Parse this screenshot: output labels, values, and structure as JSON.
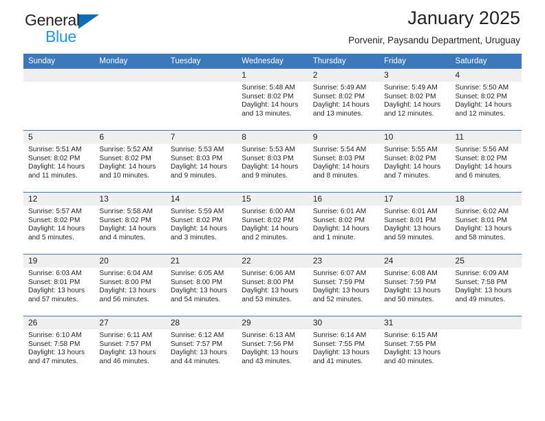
{
  "brand": {
    "line1": "General",
    "line2": "Blue",
    "triangle_color": "#0f6cb6",
    "blue_text_color": "#2196e8"
  },
  "header": {
    "title": "January 2025",
    "subtitle": "Porvenir, Paysandu Department, Uruguay"
  },
  "theme": {
    "header_blue": "#3c78bc",
    "daynum_band": "#efefef",
    "text": "#231f20"
  },
  "weekday_headers": [
    "Sunday",
    "Monday",
    "Tuesday",
    "Wednesday",
    "Thursday",
    "Friday",
    "Saturday"
  ],
  "weeks": [
    [
      {
        "day": "",
        "blank": true
      },
      {
        "day": "",
        "blank": true
      },
      {
        "day": "",
        "blank": true
      },
      {
        "day": "1",
        "sunrise": "Sunrise: 5:48 AM",
        "sunset": "Sunset: 8:02 PM",
        "daylight": "Daylight: 14 hours and 13 minutes."
      },
      {
        "day": "2",
        "sunrise": "Sunrise: 5:49 AM",
        "sunset": "Sunset: 8:02 PM",
        "daylight": "Daylight: 14 hours and 13 minutes."
      },
      {
        "day": "3",
        "sunrise": "Sunrise: 5:49 AM",
        "sunset": "Sunset: 8:02 PM",
        "daylight": "Daylight: 14 hours and 12 minutes."
      },
      {
        "day": "4",
        "sunrise": "Sunrise: 5:50 AM",
        "sunset": "Sunset: 8:02 PM",
        "daylight": "Daylight: 14 hours and 12 minutes."
      }
    ],
    [
      {
        "day": "5",
        "sunrise": "Sunrise: 5:51 AM",
        "sunset": "Sunset: 8:02 PM",
        "daylight": "Daylight: 14 hours and 11 minutes."
      },
      {
        "day": "6",
        "sunrise": "Sunrise: 5:52 AM",
        "sunset": "Sunset: 8:02 PM",
        "daylight": "Daylight: 14 hours and 10 minutes."
      },
      {
        "day": "7",
        "sunrise": "Sunrise: 5:53 AM",
        "sunset": "Sunset: 8:03 PM",
        "daylight": "Daylight: 14 hours and 9 minutes."
      },
      {
        "day": "8",
        "sunrise": "Sunrise: 5:53 AM",
        "sunset": "Sunset: 8:03 PM",
        "daylight": "Daylight: 14 hours and 9 minutes."
      },
      {
        "day": "9",
        "sunrise": "Sunrise: 5:54 AM",
        "sunset": "Sunset: 8:03 PM",
        "daylight": "Daylight: 14 hours and 8 minutes."
      },
      {
        "day": "10",
        "sunrise": "Sunrise: 5:55 AM",
        "sunset": "Sunset: 8:02 PM",
        "daylight": "Daylight: 14 hours and 7 minutes."
      },
      {
        "day": "11",
        "sunrise": "Sunrise: 5:56 AM",
        "sunset": "Sunset: 8:02 PM",
        "daylight": "Daylight: 14 hours and 6 minutes."
      }
    ],
    [
      {
        "day": "12",
        "sunrise": "Sunrise: 5:57 AM",
        "sunset": "Sunset: 8:02 PM",
        "daylight": "Daylight: 14 hours and 5 minutes."
      },
      {
        "day": "13",
        "sunrise": "Sunrise: 5:58 AM",
        "sunset": "Sunset: 8:02 PM",
        "daylight": "Daylight: 14 hours and 4 minutes."
      },
      {
        "day": "14",
        "sunrise": "Sunrise: 5:59 AM",
        "sunset": "Sunset: 8:02 PM",
        "daylight": "Daylight: 14 hours and 3 minutes."
      },
      {
        "day": "15",
        "sunrise": "Sunrise: 6:00 AM",
        "sunset": "Sunset: 8:02 PM",
        "daylight": "Daylight: 14 hours and 2 minutes."
      },
      {
        "day": "16",
        "sunrise": "Sunrise: 6:01 AM",
        "sunset": "Sunset: 8:02 PM",
        "daylight": "Daylight: 14 hours and 1 minute."
      },
      {
        "day": "17",
        "sunrise": "Sunrise: 6:01 AM",
        "sunset": "Sunset: 8:01 PM",
        "daylight": "Daylight: 13 hours and 59 minutes."
      },
      {
        "day": "18",
        "sunrise": "Sunrise: 6:02 AM",
        "sunset": "Sunset: 8:01 PM",
        "daylight": "Daylight: 13 hours and 58 minutes."
      }
    ],
    [
      {
        "day": "19",
        "sunrise": "Sunrise: 6:03 AM",
        "sunset": "Sunset: 8:01 PM",
        "daylight": "Daylight: 13 hours and 57 minutes."
      },
      {
        "day": "20",
        "sunrise": "Sunrise: 6:04 AM",
        "sunset": "Sunset: 8:00 PM",
        "daylight": "Daylight: 13 hours and 56 minutes."
      },
      {
        "day": "21",
        "sunrise": "Sunrise: 6:05 AM",
        "sunset": "Sunset: 8:00 PM",
        "daylight": "Daylight: 13 hours and 54 minutes."
      },
      {
        "day": "22",
        "sunrise": "Sunrise: 6:06 AM",
        "sunset": "Sunset: 8:00 PM",
        "daylight": "Daylight: 13 hours and 53 minutes."
      },
      {
        "day": "23",
        "sunrise": "Sunrise: 6:07 AM",
        "sunset": "Sunset: 7:59 PM",
        "daylight": "Daylight: 13 hours and 52 minutes."
      },
      {
        "day": "24",
        "sunrise": "Sunrise: 6:08 AM",
        "sunset": "Sunset: 7:59 PM",
        "daylight": "Daylight: 13 hours and 50 minutes."
      },
      {
        "day": "25",
        "sunrise": "Sunrise: 6:09 AM",
        "sunset": "Sunset: 7:58 PM",
        "daylight": "Daylight: 13 hours and 49 minutes."
      }
    ],
    [
      {
        "day": "26",
        "sunrise": "Sunrise: 6:10 AM",
        "sunset": "Sunset: 7:58 PM",
        "daylight": "Daylight: 13 hours and 47 minutes."
      },
      {
        "day": "27",
        "sunrise": "Sunrise: 6:11 AM",
        "sunset": "Sunset: 7:57 PM",
        "daylight": "Daylight: 13 hours and 46 minutes."
      },
      {
        "day": "28",
        "sunrise": "Sunrise: 6:12 AM",
        "sunset": "Sunset: 7:57 PM",
        "daylight": "Daylight: 13 hours and 44 minutes."
      },
      {
        "day": "29",
        "sunrise": "Sunrise: 6:13 AM",
        "sunset": "Sunset: 7:56 PM",
        "daylight": "Daylight: 13 hours and 43 minutes."
      },
      {
        "day": "30",
        "sunrise": "Sunrise: 6:14 AM",
        "sunset": "Sunset: 7:55 PM",
        "daylight": "Daylight: 13 hours and 41 minutes."
      },
      {
        "day": "31",
        "sunrise": "Sunrise: 6:15 AM",
        "sunset": "Sunset: 7:55 PM",
        "daylight": "Daylight: 13 hours and 40 minutes."
      },
      {
        "day": "",
        "blank": true
      }
    ]
  ]
}
